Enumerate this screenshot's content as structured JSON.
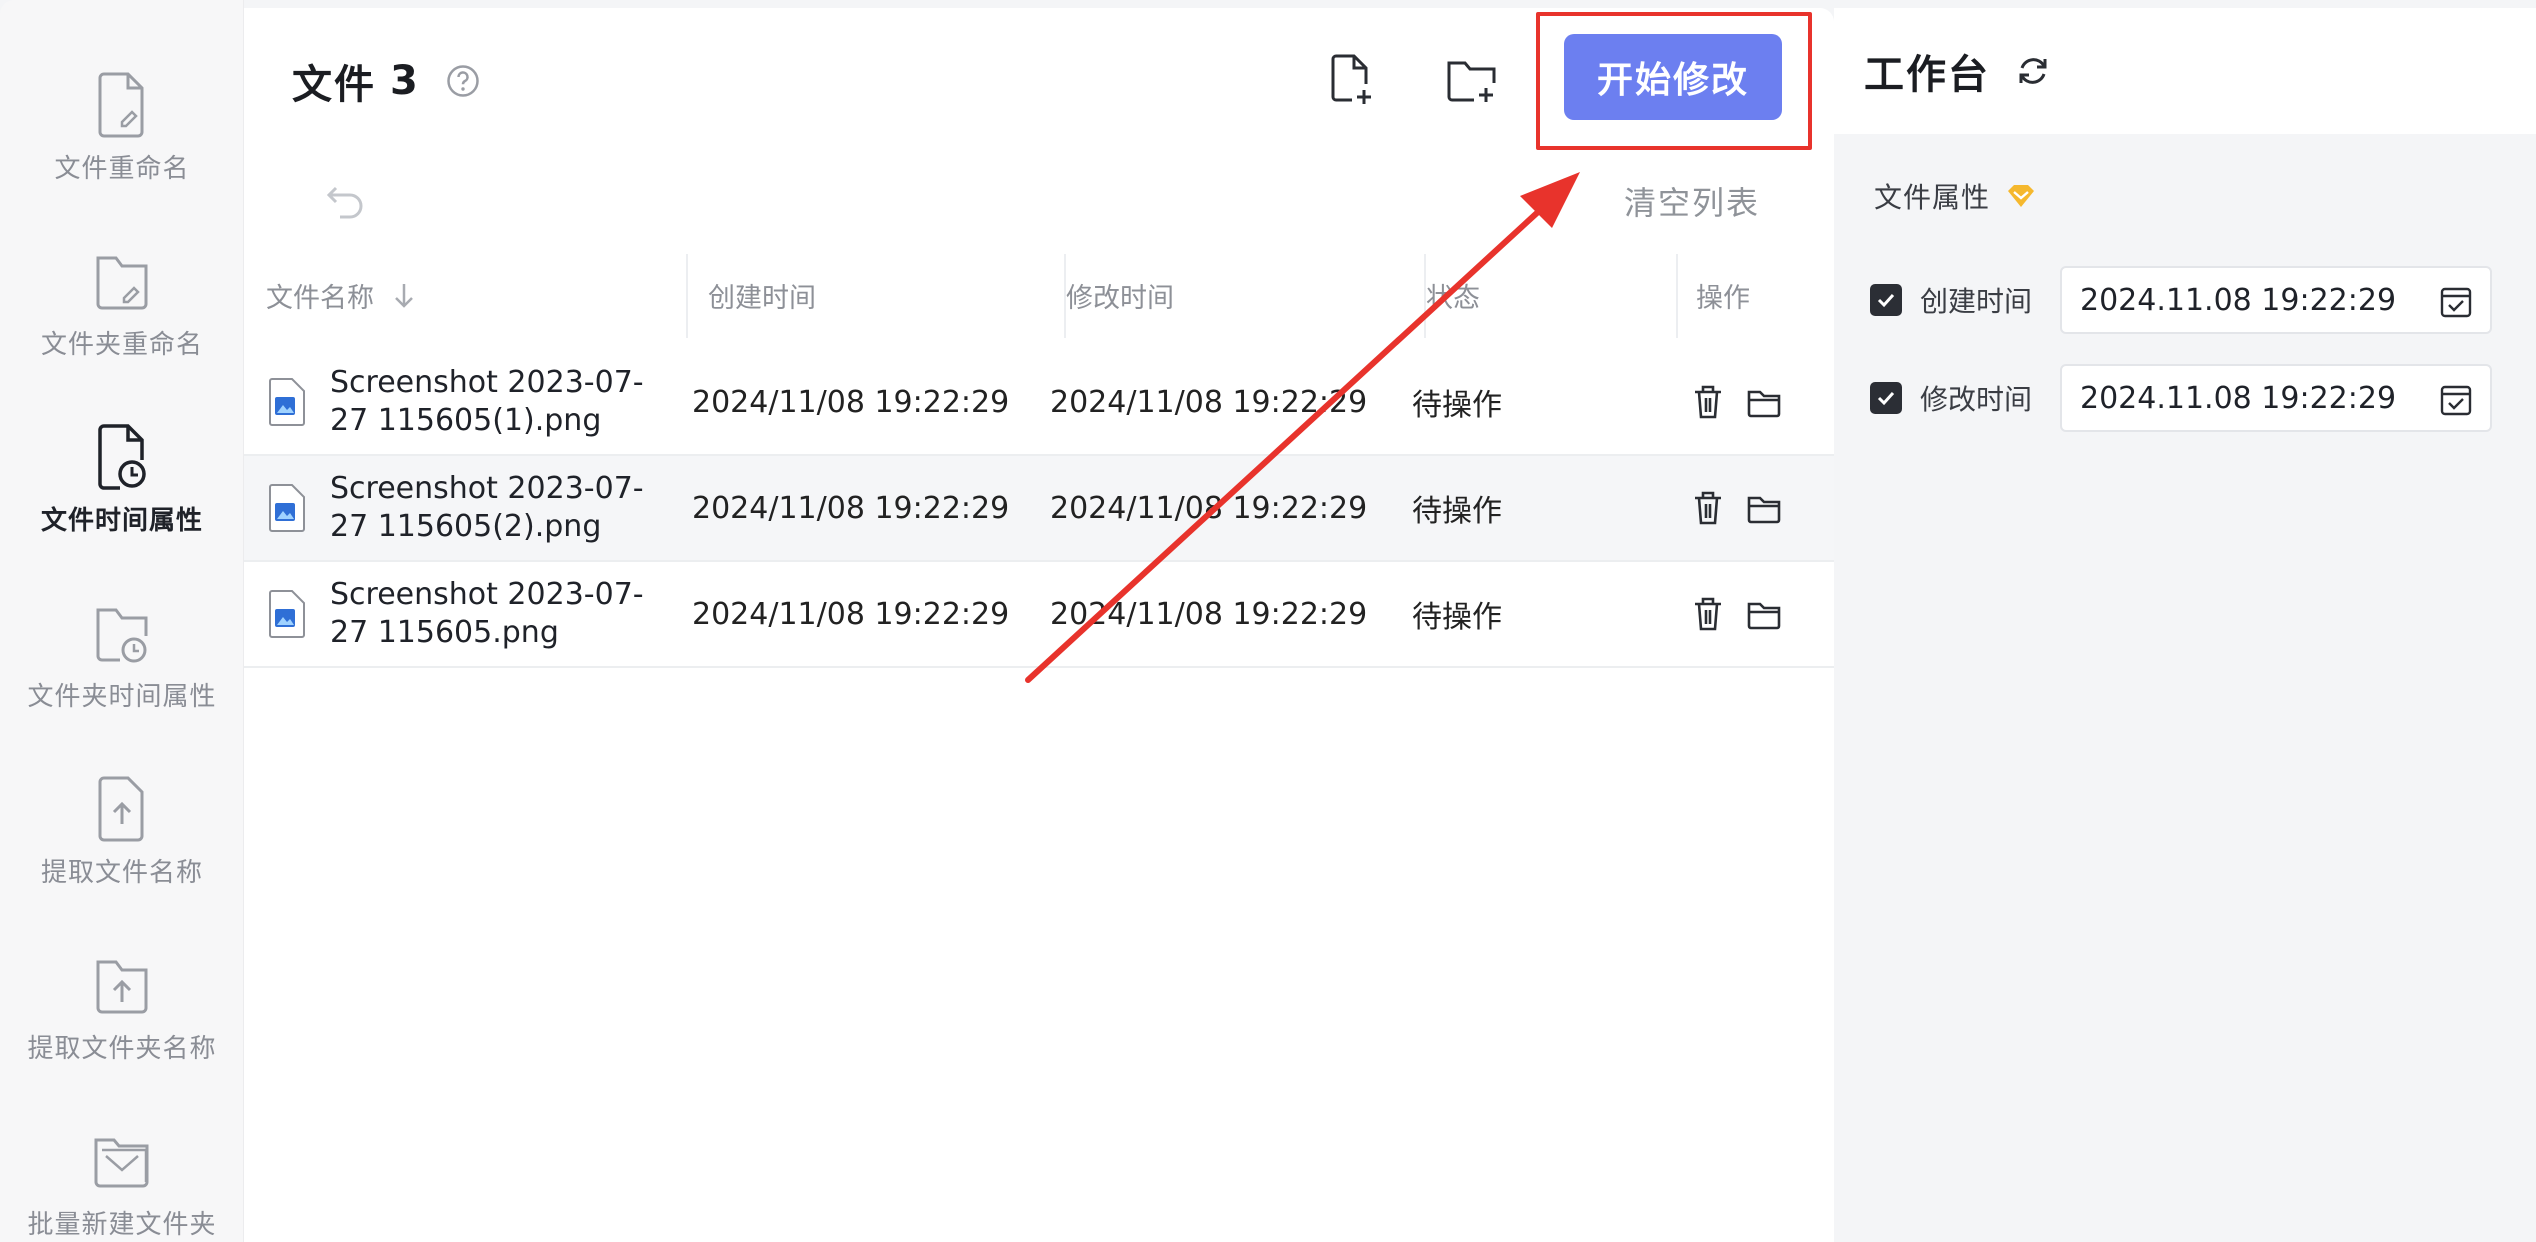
{
  "sidebar": {
    "items": [
      {
        "label": "文件重命名",
        "icon": "file-rename-icon",
        "active": false
      },
      {
        "label": "文件夹重命名",
        "icon": "folder-rename-icon",
        "active": false
      },
      {
        "label": "文件时间属性",
        "icon": "file-time-icon",
        "active": true
      },
      {
        "label": "文件夹时间属性",
        "icon": "folder-time-icon",
        "active": false
      },
      {
        "label": "提取文件名称",
        "icon": "file-extract-icon",
        "active": false
      },
      {
        "label": "提取文件夹名称",
        "icon": "folder-extract-icon",
        "active": false
      },
      {
        "label": "批量新建文件夹",
        "icon": "batch-folder-icon",
        "active": false
      }
    ]
  },
  "main": {
    "title": "文件",
    "count": "3",
    "start_button": "开始修改",
    "clear_list": "清空列表",
    "columns": {
      "name": "文件名称",
      "created": "创建时间",
      "modified": "修改时间",
      "status": "状态",
      "actions": "操作"
    },
    "rows": [
      {
        "name": "Screenshot 2023-07-27 115605(1).png",
        "created": "2024/11/08 19:22:29",
        "modified": "2024/11/08 19:22:29",
        "status": "待操作"
      },
      {
        "name": "Screenshot 2023-07-27 115605(2).png",
        "created": "2024/11/08 19:22:29",
        "modified": "2024/11/08 19:22:29",
        "status": "待操作"
      },
      {
        "name": "Screenshot 2023-07-27 115605.png",
        "created": "2024/11/08 19:22:29",
        "modified": "2024/11/08 19:22:29",
        "status": "待操作"
      }
    ]
  },
  "workbench": {
    "title": "工作台",
    "section_title": "文件属性",
    "props": [
      {
        "label": "创建时间",
        "value": "2024.11.08 19:22:29",
        "checked": true
      },
      {
        "label": "修改时间",
        "value": "2024.11.08 19:22:29",
        "checked": true
      }
    ]
  },
  "colors": {
    "accent": "#6c7ff0",
    "highlight": "#e8332c",
    "vip": "#f5b82e"
  }
}
